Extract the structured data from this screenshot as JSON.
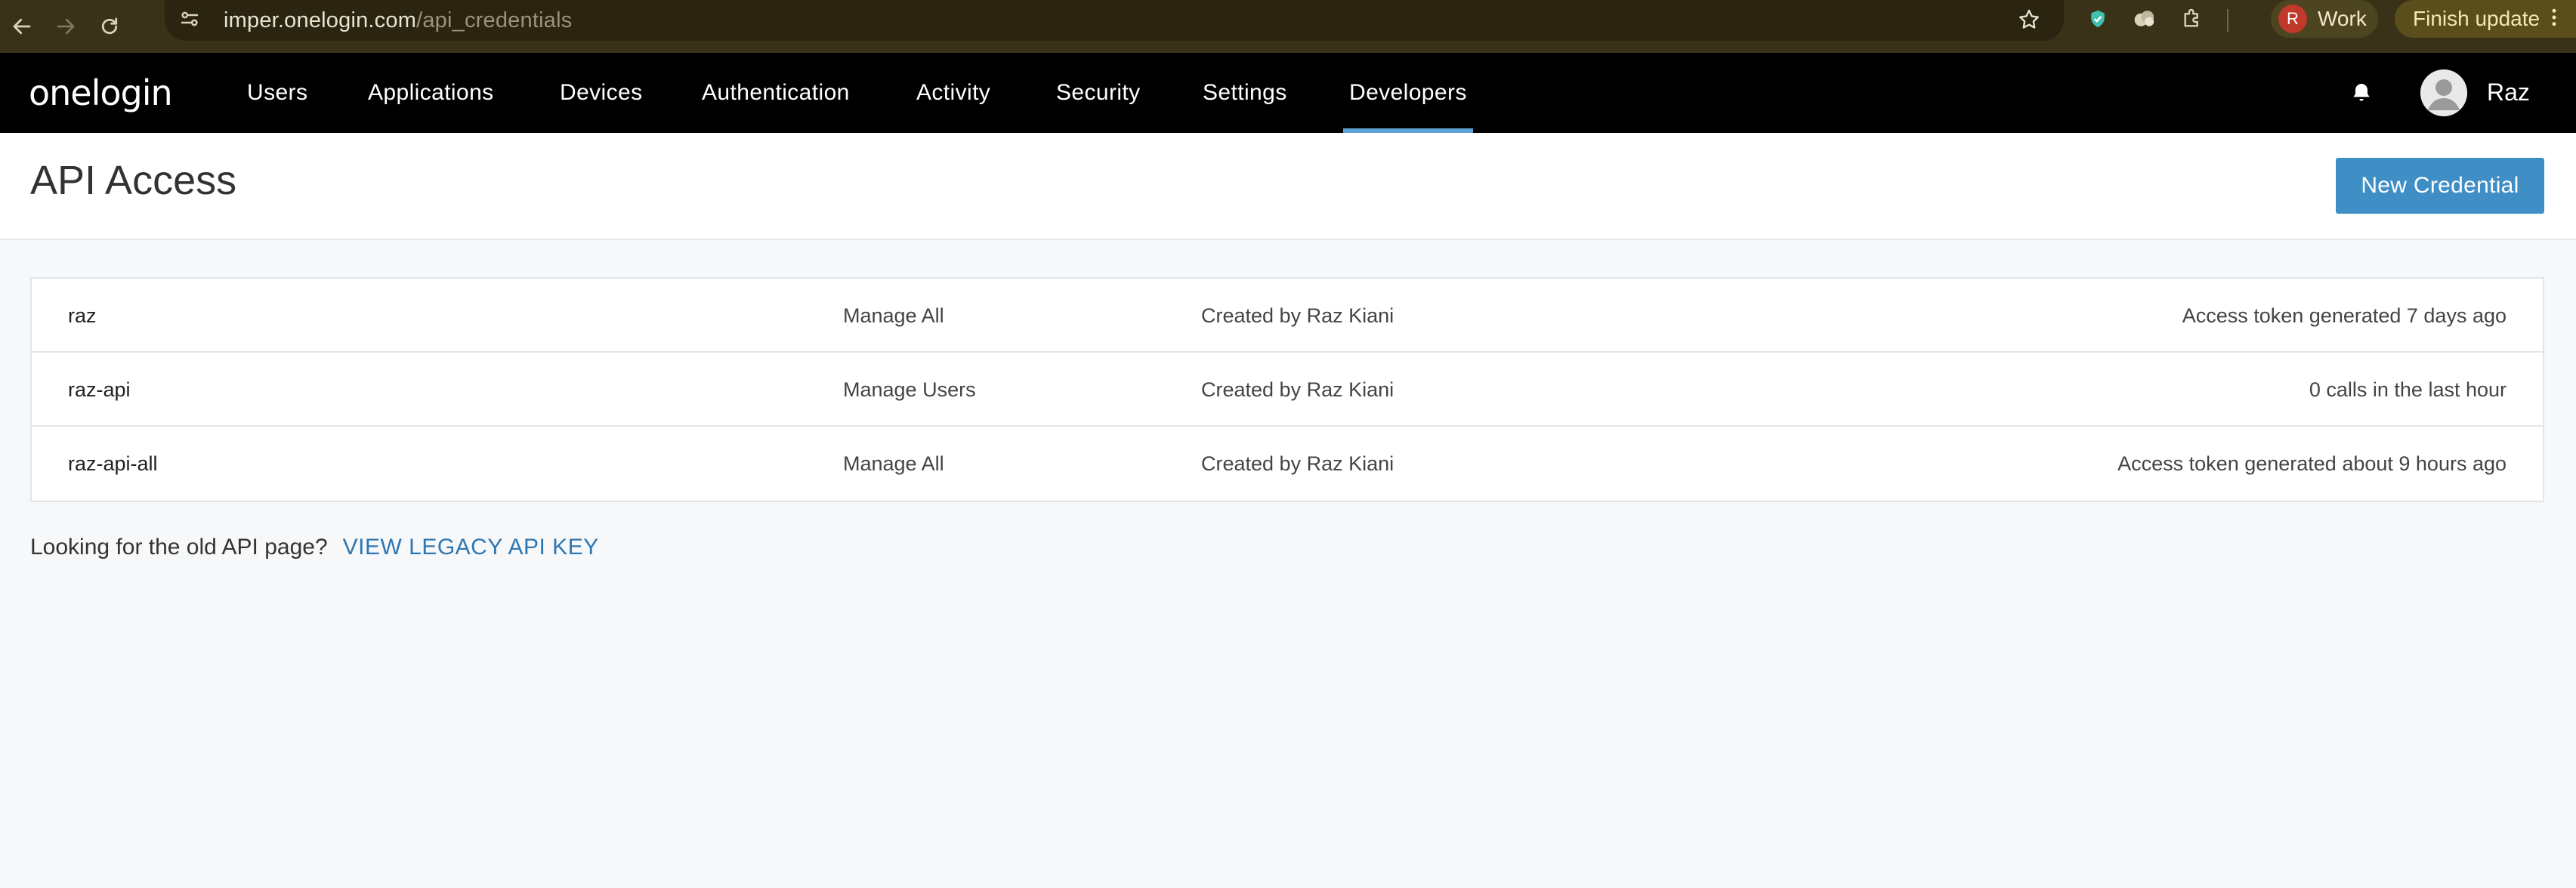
{
  "browser": {
    "url_host": "imper.onelogin.com",
    "url_path": "/api_credentials",
    "profile_initial": "R",
    "profile_label": "Work",
    "update_label": "Finish update"
  },
  "nav": {
    "logo": "onelogin",
    "items": [
      {
        "label": "Users"
      },
      {
        "label": "Applications"
      },
      {
        "label": "Devices"
      },
      {
        "label": "Authentication"
      },
      {
        "label": "Activity"
      },
      {
        "label": "Security"
      },
      {
        "label": "Settings"
      },
      {
        "label": "Developers"
      }
    ],
    "active_item": "Developers",
    "user_name": "Raz"
  },
  "header": {
    "title": "API Access",
    "new_button_label": "New Credential"
  },
  "credentials": [
    {
      "name": "raz",
      "scope": "Manage All",
      "creator": "Created by Raz Kiani",
      "status": "Access token generated 7 days ago"
    },
    {
      "name": "raz-api",
      "scope": "Manage Users",
      "creator": "Created by Raz Kiani",
      "status": "0 calls in the last hour"
    },
    {
      "name": "raz-api-all",
      "scope": "Manage All",
      "creator": "Created by Raz Kiani",
      "status": "Access token generated about 9 hours ago"
    }
  ],
  "legacy": {
    "prompt": "Looking for the old API page?",
    "link_label": "VIEW LEGACY API KEY"
  },
  "colors": {
    "chrome_bg": "#3a3218",
    "nav_bg": "#000000",
    "accent": "#3f8ec5",
    "active_tab_underline": "#5fa3d6",
    "link": "#2f77b3"
  }
}
